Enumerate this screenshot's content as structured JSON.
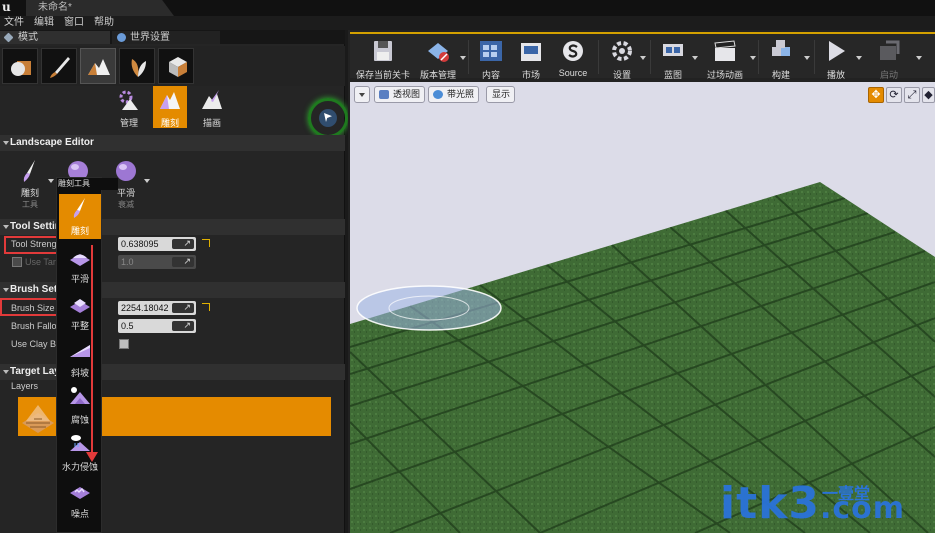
{
  "window": {
    "title": "未命名*"
  },
  "menu": [
    "文件",
    "编辑",
    "窗口",
    "帮助"
  ],
  "panel_tabs": {
    "modes": "模式",
    "world_settings": "世界设置"
  },
  "landscape_modes": {
    "manage": "管理",
    "sculpt": "雕刻",
    "paint": "描画"
  },
  "sections": {
    "landscape_editor": "Landscape Editor",
    "tool_settings": "Tool Settin",
    "brush_settings": "Brush Sett",
    "target_layers": "Target Lay",
    "layers": "Layers"
  },
  "tool_row": {
    "sculpt_l1": "雕刻",
    "sculpt_l2": "工具",
    "smooth_l1": "平滑",
    "smooth_l2": "衰减"
  },
  "properties": {
    "tool_strength": {
      "label": "Tool Strengt",
      "value": "0.638095"
    },
    "use_target": {
      "label": "Use Targ",
      "value": "1.0"
    },
    "brush_size": {
      "label": "Brush Size",
      "value": "2254.18042"
    },
    "brush_falloff": {
      "label": "Brush Fallof",
      "value": "0.5"
    },
    "use_clay_brush": {
      "label": "Use Clay Br"
    }
  },
  "dropdown": {
    "title": "雕刻工具",
    "items": [
      "雕刻",
      "平滑",
      "平整",
      "斜坡",
      "腐蚀",
      "水力侵蚀",
      "噪点"
    ]
  },
  "toolbar": {
    "save": "保存当前关卡",
    "source_control": "版本管理",
    "content": "内容",
    "marketplace": "市场",
    "source": "Source",
    "settings": "设置",
    "blueprints": "蓝图",
    "cinematics": "过场动画",
    "build": "构建",
    "play": "播放",
    "launch": "启动"
  },
  "viewport": {
    "perspective": "透视图",
    "lit": "带光照",
    "show": "显示"
  },
  "watermark": {
    "main": "itk3",
    "sub": "一壹堂",
    "suffix": ".com"
  }
}
